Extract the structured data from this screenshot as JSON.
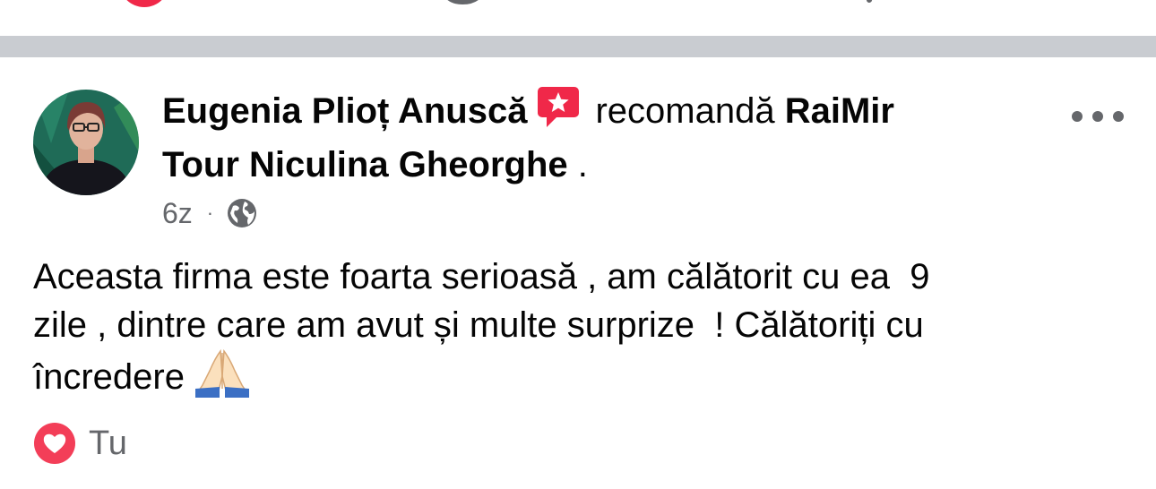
{
  "post": {
    "author": "Eugenia Plioț Anuscă",
    "verb": "recomandă",
    "page_line1": "RaiMir",
    "page_line2": "Tour Niculina Gheorghe",
    "period": ".",
    "time": "6z",
    "separator": "·",
    "privacy_icon": "globe-icon",
    "body_lines": [
      "Aceasta firma este foarta serioasă , am călătorit cu ea  9",
      "zile , dintre care am avut și multe surprize  ! Călătoriți cu",
      "încredere"
    ],
    "emoji": "folded-hands-emoji",
    "reaction_icon": "heart-icon",
    "reaction_label": "Tu"
  },
  "colors": {
    "badge": "#f02849",
    "love": "#f33e58",
    "divider": "#c9ccd1",
    "secondary_text": "#65676b"
  }
}
